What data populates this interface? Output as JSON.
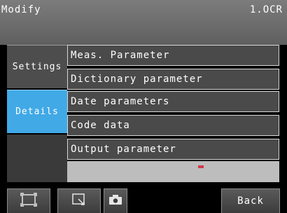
{
  "header": {
    "title": "Modify",
    "mode": "1.OCR"
  },
  "tabs": [
    {
      "label": "Settings",
      "active": false
    },
    {
      "label": "Details",
      "active": true
    }
  ],
  "menu": {
    "items": [
      {
        "label": "Meas. Parameter"
      },
      {
        "label": "Dictionary parameter"
      },
      {
        "label": "Date parameters"
      },
      {
        "label": "Code data"
      },
      {
        "label": "Output parameter"
      }
    ]
  },
  "toolbar": {
    "icons": [
      "frame-icon",
      "zoom-window-icon",
      "camera-icon"
    ],
    "back_label": "Back"
  },
  "colors": {
    "active_tab": "#41a9e6",
    "header": "#6e6e6e",
    "preview_bg": "#bdbdbd",
    "marker": "#d13a4a"
  }
}
